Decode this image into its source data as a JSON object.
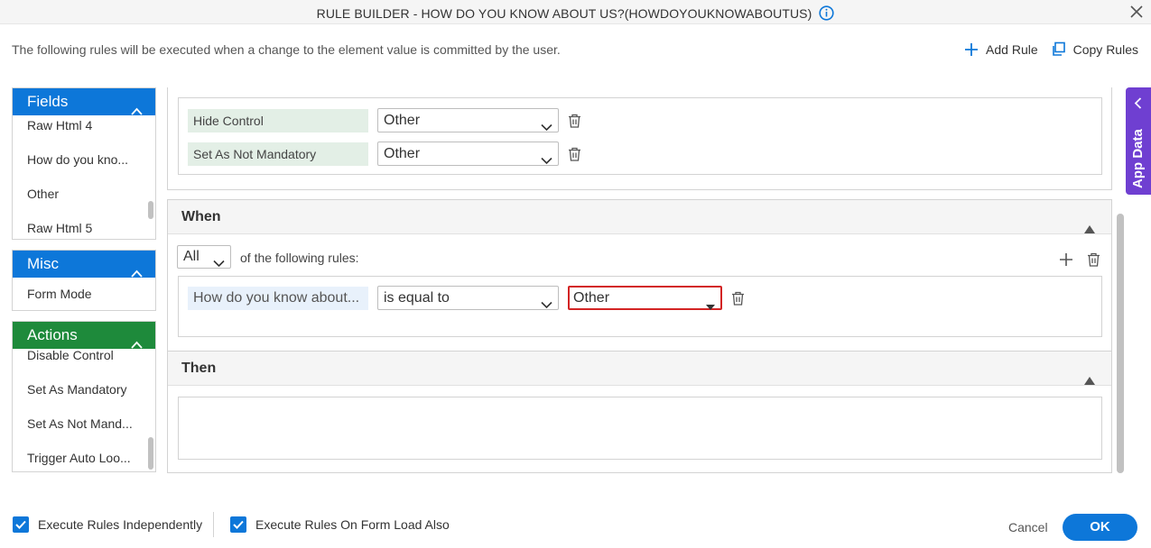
{
  "title": "RULE BUILDER - HOW DO YOU KNOW ABOUT US?(HOWDOYOUKNOWABOUTUS)",
  "description": "The following rules will be executed when a change to the element value is committed by the user.",
  "toolbar": {
    "add_rule": "Add Rule",
    "copy_rules": "Copy Rules"
  },
  "fields": {
    "header": "Fields",
    "items": [
      "Raw Html 4",
      "How do you kno...",
      "Other",
      "Raw Html 5"
    ]
  },
  "misc": {
    "header": "Misc",
    "items": [
      "Form Mode"
    ]
  },
  "actions_panel": {
    "header": "Actions",
    "items": [
      "Disable Control",
      "Set As Mandatory",
      "Set As Not Mand...",
      "Trigger Auto Loo..."
    ]
  },
  "rule_actions": [
    {
      "label": "Hide Control",
      "value": "Other"
    },
    {
      "label": "Set As Not Mandatory",
      "value": "Other"
    }
  ],
  "when": {
    "header": "When",
    "match": "All",
    "match_suffix": "of the following rules:",
    "condition": {
      "field": "How do you know about...",
      "operator": "is equal to",
      "value": "Other"
    }
  },
  "then": {
    "header": "Then"
  },
  "app_data": "App Data",
  "footer": {
    "execute_independently": "Execute Rules Independently",
    "execute_on_load": "Execute Rules On Form Load Also",
    "cancel": "Cancel",
    "ok": "OK"
  },
  "colors": {
    "primary": "#0d77d9",
    "actions_green": "#1e8a3b",
    "app_data_purple": "#6f3fd1",
    "error_red": "#d32424"
  }
}
